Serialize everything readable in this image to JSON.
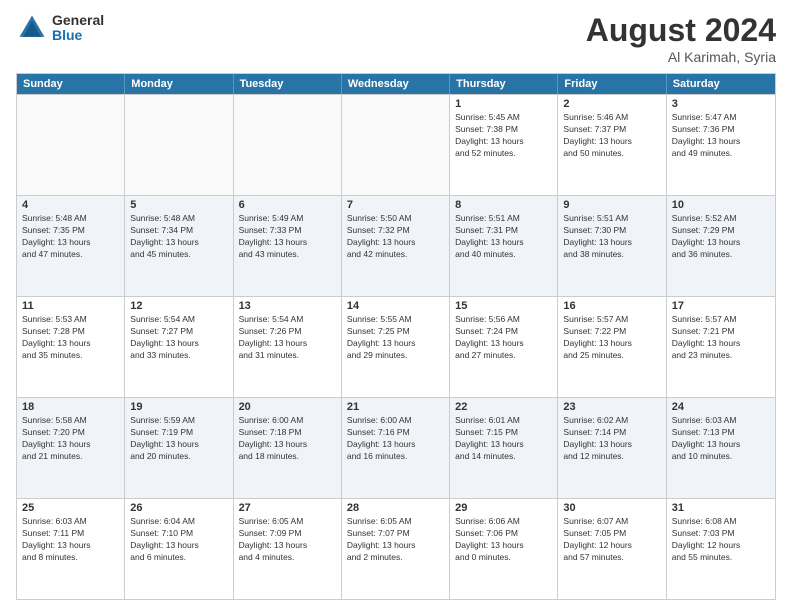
{
  "logo": {
    "general": "General",
    "blue": "Blue"
  },
  "title": "August 2024",
  "subtitle": "Al Karimah, Syria",
  "days": [
    "Sunday",
    "Monday",
    "Tuesday",
    "Wednesday",
    "Thursday",
    "Friday",
    "Saturday"
  ],
  "weeks": [
    [
      {
        "day": "",
        "info": ""
      },
      {
        "day": "",
        "info": ""
      },
      {
        "day": "",
        "info": ""
      },
      {
        "day": "",
        "info": ""
      },
      {
        "day": "1",
        "info": "Sunrise: 5:45 AM\nSunset: 7:38 PM\nDaylight: 13 hours\nand 52 minutes."
      },
      {
        "day": "2",
        "info": "Sunrise: 5:46 AM\nSunset: 7:37 PM\nDaylight: 13 hours\nand 50 minutes."
      },
      {
        "day": "3",
        "info": "Sunrise: 5:47 AM\nSunset: 7:36 PM\nDaylight: 13 hours\nand 49 minutes."
      }
    ],
    [
      {
        "day": "4",
        "info": "Sunrise: 5:48 AM\nSunset: 7:35 PM\nDaylight: 13 hours\nand 47 minutes."
      },
      {
        "day": "5",
        "info": "Sunrise: 5:48 AM\nSunset: 7:34 PM\nDaylight: 13 hours\nand 45 minutes."
      },
      {
        "day": "6",
        "info": "Sunrise: 5:49 AM\nSunset: 7:33 PM\nDaylight: 13 hours\nand 43 minutes."
      },
      {
        "day": "7",
        "info": "Sunrise: 5:50 AM\nSunset: 7:32 PM\nDaylight: 13 hours\nand 42 minutes."
      },
      {
        "day": "8",
        "info": "Sunrise: 5:51 AM\nSunset: 7:31 PM\nDaylight: 13 hours\nand 40 minutes."
      },
      {
        "day": "9",
        "info": "Sunrise: 5:51 AM\nSunset: 7:30 PM\nDaylight: 13 hours\nand 38 minutes."
      },
      {
        "day": "10",
        "info": "Sunrise: 5:52 AM\nSunset: 7:29 PM\nDaylight: 13 hours\nand 36 minutes."
      }
    ],
    [
      {
        "day": "11",
        "info": "Sunrise: 5:53 AM\nSunset: 7:28 PM\nDaylight: 13 hours\nand 35 minutes."
      },
      {
        "day": "12",
        "info": "Sunrise: 5:54 AM\nSunset: 7:27 PM\nDaylight: 13 hours\nand 33 minutes."
      },
      {
        "day": "13",
        "info": "Sunrise: 5:54 AM\nSunset: 7:26 PM\nDaylight: 13 hours\nand 31 minutes."
      },
      {
        "day": "14",
        "info": "Sunrise: 5:55 AM\nSunset: 7:25 PM\nDaylight: 13 hours\nand 29 minutes."
      },
      {
        "day": "15",
        "info": "Sunrise: 5:56 AM\nSunset: 7:24 PM\nDaylight: 13 hours\nand 27 minutes."
      },
      {
        "day": "16",
        "info": "Sunrise: 5:57 AM\nSunset: 7:22 PM\nDaylight: 13 hours\nand 25 minutes."
      },
      {
        "day": "17",
        "info": "Sunrise: 5:57 AM\nSunset: 7:21 PM\nDaylight: 13 hours\nand 23 minutes."
      }
    ],
    [
      {
        "day": "18",
        "info": "Sunrise: 5:58 AM\nSunset: 7:20 PM\nDaylight: 13 hours\nand 21 minutes."
      },
      {
        "day": "19",
        "info": "Sunrise: 5:59 AM\nSunset: 7:19 PM\nDaylight: 13 hours\nand 20 minutes."
      },
      {
        "day": "20",
        "info": "Sunrise: 6:00 AM\nSunset: 7:18 PM\nDaylight: 13 hours\nand 18 minutes."
      },
      {
        "day": "21",
        "info": "Sunrise: 6:00 AM\nSunset: 7:16 PM\nDaylight: 13 hours\nand 16 minutes."
      },
      {
        "day": "22",
        "info": "Sunrise: 6:01 AM\nSunset: 7:15 PM\nDaylight: 13 hours\nand 14 minutes."
      },
      {
        "day": "23",
        "info": "Sunrise: 6:02 AM\nSunset: 7:14 PM\nDaylight: 13 hours\nand 12 minutes."
      },
      {
        "day": "24",
        "info": "Sunrise: 6:03 AM\nSunset: 7:13 PM\nDaylight: 13 hours\nand 10 minutes."
      }
    ],
    [
      {
        "day": "25",
        "info": "Sunrise: 6:03 AM\nSunset: 7:11 PM\nDaylight: 13 hours\nand 8 minutes."
      },
      {
        "day": "26",
        "info": "Sunrise: 6:04 AM\nSunset: 7:10 PM\nDaylight: 13 hours\nand 6 minutes."
      },
      {
        "day": "27",
        "info": "Sunrise: 6:05 AM\nSunset: 7:09 PM\nDaylight: 13 hours\nand 4 minutes."
      },
      {
        "day": "28",
        "info": "Sunrise: 6:05 AM\nSunset: 7:07 PM\nDaylight: 13 hours\nand 2 minutes."
      },
      {
        "day": "29",
        "info": "Sunrise: 6:06 AM\nSunset: 7:06 PM\nDaylight: 13 hours\nand 0 minutes."
      },
      {
        "day": "30",
        "info": "Sunrise: 6:07 AM\nSunset: 7:05 PM\nDaylight: 12 hours\nand 57 minutes."
      },
      {
        "day": "31",
        "info": "Sunrise: 6:08 AM\nSunset: 7:03 PM\nDaylight: 12 hours\nand 55 minutes."
      }
    ]
  ]
}
